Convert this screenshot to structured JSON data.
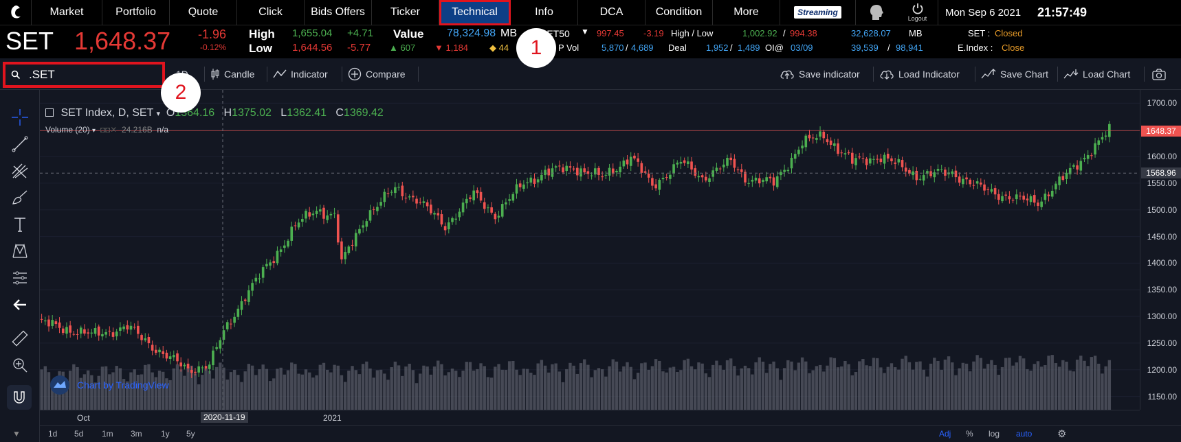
{
  "nav": {
    "tabs": [
      "Market",
      "Portfolio",
      "Quote",
      "Click",
      "Bids Offers",
      "Ticker",
      "Technical",
      "Info",
      "DCA",
      "Condition",
      "More"
    ],
    "active_tab": "Technical",
    "streaming_label": "Streaming",
    "logout_label": "Logout",
    "date": "Mon Sep 6 2021",
    "time": "21:57:49"
  },
  "quote": {
    "symbol": "SET",
    "last": "1,648.37",
    "change": "-1.96",
    "change_pct": "-0.12%",
    "high_label": "High",
    "high": "1,655.04",
    "high_chg": "+4.71",
    "low_label": "Low",
    "low": "1,644.56",
    "low_chg": "-5.77",
    "value_label": "Value",
    "value": "78,324.98",
    "value_unit": "MB",
    "up_count": "607",
    "down_count": "1,184",
    "unch_count": "44",
    "set50_label": "SET50",
    "set50_value": "997.45",
    "set50_chg": "-3.19",
    "hl_label": "High / Low",
    "hl_high": "1,002.92",
    "hl_low": "994.38",
    "hl_sep": "/",
    "big_value": "32,628.07",
    "big_unit": "MB",
    "set_status_label": "SET :",
    "set_status": "Closed",
    "vol_label": "P Vol",
    "vol_a": "5,870",
    "vol_b": "4,689",
    "deal_label": "Deal",
    "deal_a": "1,952",
    "deal_b": "1,489",
    "oi_label": "OI@",
    "oi_date": "03/09",
    "oi_a": "39,539",
    "oi_b": "98,941",
    "eindex_label": "E.Index :",
    "eindex_status": "Close"
  },
  "toolbar": {
    "search_value": ".SET",
    "interval": "1D",
    "candle": "Candle",
    "indicator": "Indicator",
    "compare": "Compare",
    "save_indicator": "Save indicator",
    "load_indicator": "Load Indicator",
    "save_chart": "Save Chart",
    "load_chart": "Load Chart"
  },
  "callouts": [
    "1",
    "2"
  ],
  "legend": {
    "title": "SET Index, D, SET",
    "o_label": "O",
    "o": "1364.16",
    "h_label": "H",
    "h": "1375.02",
    "l_label": "L",
    "l": "1362.41",
    "c_label": "C",
    "c": "1369.42",
    "volume_label": "Volume (20)",
    "volume_value": "24.216B",
    "volume_ma": "n/a"
  },
  "watermark": "Chart by TradingView",
  "colors": {
    "up": "#4caf50",
    "down": "#ef5350",
    "volume": "#5d606b",
    "accent": "#2962ff",
    "highlight": "#e0141e"
  },
  "chart_data": {
    "type": "candlestick",
    "title": "SET Index, D, SET",
    "ylim": [
      1125,
      1725
    ],
    "y_ticks": [
      1700,
      1650,
      1600,
      1550,
      1500,
      1450,
      1400,
      1350,
      1300,
      1250,
      1200,
      1150
    ],
    "tick_labels": [
      "1700.00",
      "1650.00",
      "1600.00",
      "1550.00",
      "1500.00",
      "1450.00",
      "1400.00",
      "1350.00",
      "1300.00",
      "1250.00",
      "1200.00",
      "1150.00"
    ],
    "last_price_tag": "1648.37",
    "crosshair_price_tag": "1568.96",
    "crosshair_time_tag": "2020-11-19",
    "x_labels": [
      "Oct",
      "2021"
    ],
    "series": [
      {
        "name": "close",
        "waypoints": [
          [
            0,
            1290
          ],
          [
            15,
            1265
          ],
          [
            25,
            1280
          ],
          [
            35,
            1230
          ],
          [
            42,
            1200
          ],
          [
            48,
            1210
          ],
          [
            52,
            1270
          ],
          [
            58,
            1340
          ],
          [
            66,
            1410
          ],
          [
            72,
            1470
          ],
          [
            78,
            1500
          ],
          [
            83,
            1490
          ],
          [
            85,
            1400
          ],
          [
            92,
            1490
          ],
          [
            100,
            1540
          ],
          [
            106,
            1520
          ],
          [
            114,
            1470
          ],
          [
            122,
            1530
          ],
          [
            128,
            1490
          ],
          [
            136,
            1550
          ],
          [
            142,
            1570
          ],
          [
            150,
            1580
          ],
          [
            158,
            1560
          ],
          [
            166,
            1600
          ],
          [
            172,
            1545
          ],
          [
            180,
            1590
          ],
          [
            186,
            1560
          ],
          [
            194,
            1590
          ],
          [
            198,
            1560
          ],
          [
            206,
            1550
          ],
          [
            214,
            1625
          ],
          [
            220,
            1640
          ],
          [
            228,
            1590
          ],
          [
            236,
            1600
          ],
          [
            246,
            1565
          ],
          [
            256,
            1570
          ],
          [
            264,
            1540
          ],
          [
            274,
            1520
          ],
          [
            280,
            1515
          ],
          [
            288,
            1565
          ],
          [
            296,
            1620
          ],
          [
            300,
            1648
          ]
        ]
      }
    ]
  },
  "time_ranges": [
    "1d",
    "5d",
    "1m",
    "3m",
    "1y",
    "5y"
  ],
  "scale_toggles": [
    "Adj",
    "%",
    "log",
    "auto"
  ]
}
